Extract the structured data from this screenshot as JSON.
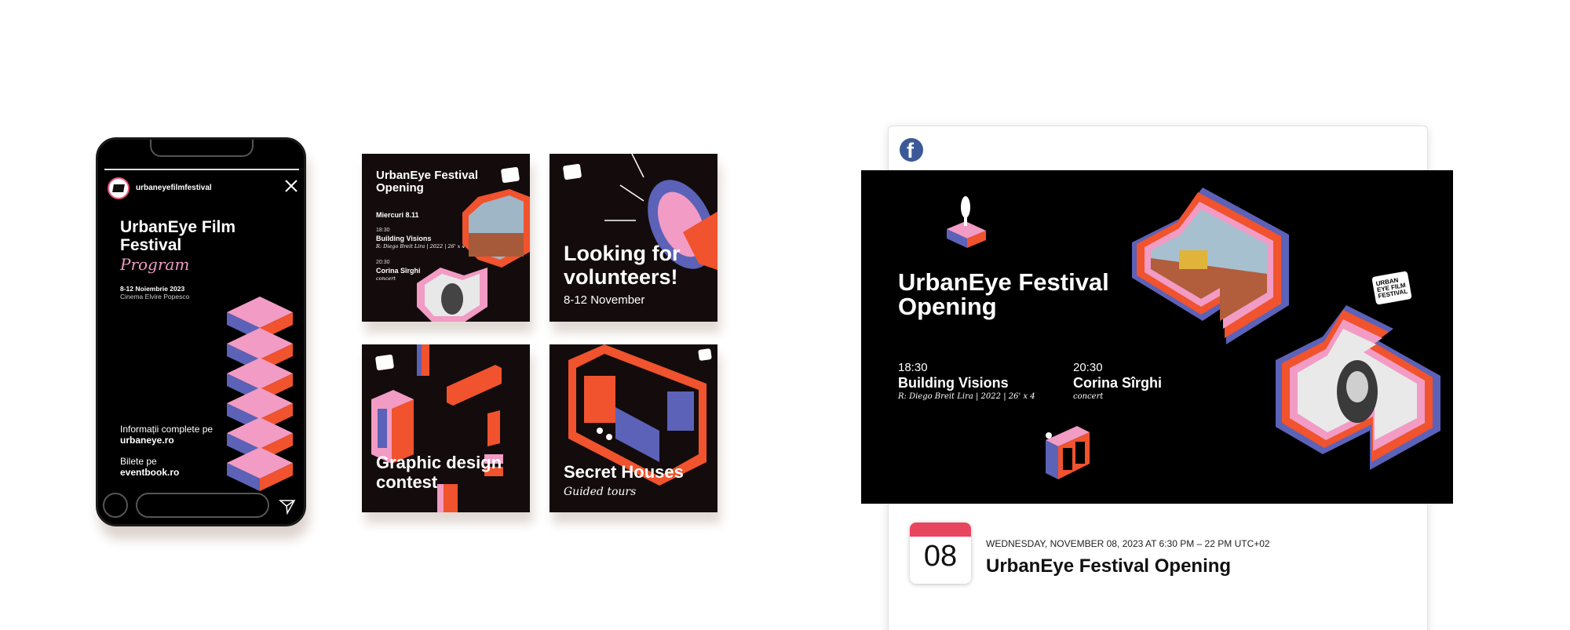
{
  "story": {
    "handle": "urbaneyefilmfestival",
    "title": "UrbanEye Film Festival",
    "subtitle": "Program",
    "dates": "8-12 Noiembrie 2023",
    "venue": "Cinema Elvire Popesco",
    "info_text": "Informații complete pe",
    "info_site": "urbaneye.ro",
    "tickets_text": "Bilete pe",
    "tickets_site": "eventbook.ro"
  },
  "tiles": {
    "opening": {
      "title": "UrbanEye Festival Opening",
      "day": "Miercuri   8.11",
      "time1": "18:30",
      "event1": "Building Visions",
      "credit1": "R: Diego Breit Lira | 2022 | 26' x 4",
      "time2": "20:30",
      "event2": "Corina Sîrghi",
      "credit2": "concert"
    },
    "volunteers": {
      "title": "Looking for volunteers!",
      "subtitle": "8-12 November"
    },
    "contest": {
      "title": "Graphic design contest"
    },
    "houses": {
      "title": "Secret Houses",
      "subtitle": "Guided tours"
    }
  },
  "facebook": {
    "banner": {
      "title": "UrbanEye Festival Opening",
      "time1": "18:30",
      "event1": "Building Visions",
      "credit1": "R: Diego Breit Lira | 2022 | 26' x 4",
      "time2": "20:30",
      "event2": "Corina Sîrghi",
      "credit2": "concert",
      "logo_text": "URBAN EYE FILM FESTIVAL"
    },
    "calendar_day": "08",
    "event_date": "WEDNESDAY, NOVEMBER 08, 2023 AT 6:30 PM – 22 PM UTC+02",
    "event_title": "UrbanEye Festival Opening"
  },
  "colors": {
    "orange": "#f0532d",
    "pink": "#f29bc4",
    "blue": "#5b62b8",
    "fb_blue": "#3b5998",
    "calendar_red": "#e8455f"
  }
}
